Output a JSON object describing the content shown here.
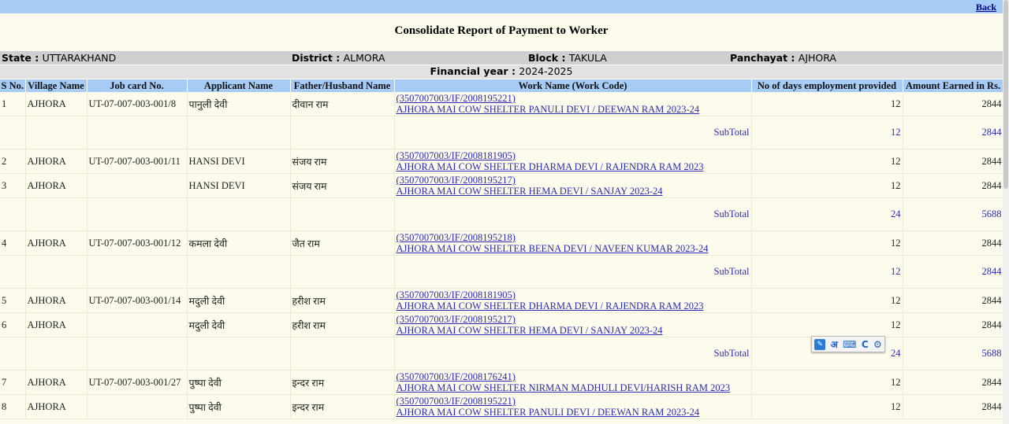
{
  "nav": {
    "back_label": "Back"
  },
  "page_title": "Consolidate Report of Payment to Worker",
  "info": {
    "state_label": "State : ",
    "state_value": "UTTARAKHAND",
    "district_label": "District : ",
    "district_value": "ALMORA",
    "block_label": "Block : ",
    "block_value": "TAKULA",
    "panchayat_label": "Panchayat : ",
    "panchayat_value": "AJHORA",
    "fy_label": "Financial year : ",
    "fy_value": "2024-2025"
  },
  "table": {
    "headers": [
      "S No.",
      "Village Name",
      "Job card No.",
      "Applicant Name",
      "Father/Husband Name",
      "Work Name (Work Code)",
      "No of days employment provided",
      "Amount Earned in Rs."
    ],
    "subtotal_label": "SubTotal",
    "rows": [
      {
        "type": "data",
        "sno": "1",
        "village": "AJHORA",
        "jobcard": "UT-07-007-003-001/8",
        "applicant": "पानुली देवी",
        "father": "दीवान राम",
        "work_code": "(3507007003/IF/2008195221)",
        "work_name": "AJHORA MAI COW SHELTER PANULI DEVI / DEEWAN RAM 2023-24",
        "days": "12",
        "amount": "2844"
      },
      {
        "type": "subtotal",
        "days": "12",
        "amount": "2844"
      },
      {
        "type": "data",
        "sno": "2",
        "village": "AJHORA",
        "jobcard": "UT-07-007-003-001/11",
        "applicant": "HANSI DEVI",
        "father": "संजय राम",
        "work_code": "(3507007003/IF/2008181905)",
        "work_name": "AJHORA MAI COW SHELTER DHARMA DEVI / RAJENDRA RAM 2023",
        "days": "12",
        "amount": "2844"
      },
      {
        "type": "data",
        "sno": "3",
        "village": "AJHORA",
        "jobcard": "",
        "applicant": "HANSI DEVI",
        "father": "संजय राम",
        "work_code": "(3507007003/IF/2008195217)",
        "work_name": "AJHORA MAI COW SHELTER HEMA DEVI / SANJAY 2023-24",
        "days": "12",
        "amount": "2844"
      },
      {
        "type": "subtotal",
        "days": "24",
        "amount": "5688"
      },
      {
        "type": "data",
        "sno": "4",
        "village": "AJHORA",
        "jobcard": "UT-07-007-003-001/12",
        "applicant": "कमला देवी",
        "father": "जैत राम",
        "work_code": "(3507007003/IF/2008195218)",
        "work_name": "AJHORA MAI COW SHELTER BEENA DEVI / NAVEEN KUMAR 2023-24",
        "days": "12",
        "amount": "2844"
      },
      {
        "type": "subtotal",
        "days": "12",
        "amount": "2844"
      },
      {
        "type": "data",
        "sno": "5",
        "village": "AJHORA",
        "jobcard": "UT-07-007-003-001/14",
        "applicant": "मदुली देवी",
        "father": "हरीश राम",
        "work_code": "(3507007003/IF/2008181905)",
        "work_name": "AJHORA MAI COW SHELTER DHARMA DEVI / RAJENDRA RAM 2023",
        "days": "12",
        "amount": "2844"
      },
      {
        "type": "data",
        "sno": "6",
        "village": "AJHORA",
        "jobcard": "",
        "applicant": "मदुली देवी",
        "father": "हरीश राम",
        "work_code": "(3507007003/IF/2008195217)",
        "work_name": "AJHORA MAI COW SHELTER HEMA DEVI / SANJAY 2023-24",
        "days": "12",
        "amount": "2844"
      },
      {
        "type": "subtotal",
        "days": "24",
        "amount": "5688"
      },
      {
        "type": "data",
        "sno": "7",
        "village": "AJHORA",
        "jobcard": "UT-07-007-003-001/27",
        "applicant": "पुष्पा देवी",
        "father": "इन्दर राम",
        "work_code": "(3507007003/IF/2008176241)",
        "work_name": "AJHORA MAI COW SHELTER NIRMAN MADHULI DEVI/HARISH RAM 2023",
        "days": "12",
        "amount": "2844"
      },
      {
        "type": "data",
        "sno": "8",
        "village": "AJHORA",
        "jobcard": "",
        "applicant": "पुष्पा देवी",
        "father": "इन्दर राम",
        "work_code": "(3507007003/IF/2008195221)",
        "work_name": "AJHORA MAI COW SHELTER PANULI DEVI / DEEWAN RAM 2023-24",
        "days": "12",
        "amount": "2844"
      }
    ]
  },
  "toolbar": {
    "hindi_label": "अ",
    "c_label": "C"
  }
}
